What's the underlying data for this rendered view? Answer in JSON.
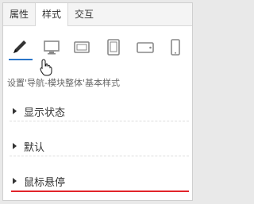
{
  "tabs": [
    {
      "label": "属性",
      "active": false
    },
    {
      "label": "样式",
      "active": true
    },
    {
      "label": "交互",
      "active": false
    }
  ],
  "device_icons": [
    {
      "name": "pencil-icon",
      "active": true
    },
    {
      "name": "desktop-icon",
      "active": false
    },
    {
      "name": "laptop-icon",
      "active": false
    },
    {
      "name": "tablet-portrait-icon",
      "active": false
    },
    {
      "name": "tablet-landscape-icon",
      "active": false
    },
    {
      "name": "phone-icon",
      "active": false
    }
  ],
  "hint_text": "设置'导航-模块整体'基本样式",
  "sections": [
    {
      "label": "显示状态"
    },
    {
      "label": "默认"
    },
    {
      "label": "鼠标悬停"
    }
  ],
  "colors": {
    "accent": "#2a75c9",
    "highlight_underline": "#e2232a"
  }
}
